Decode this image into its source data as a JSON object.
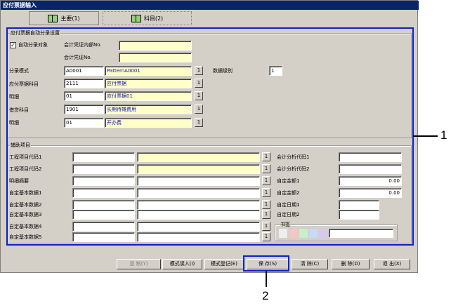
{
  "window": {
    "title": "应付票据输入"
  },
  "tabs": [
    {
      "label": "主要(1)",
      "icon": "book-icon"
    },
    {
      "label": "科目(2)",
      "icon": "book-icon"
    }
  ],
  "auto": {
    "group_title": "应付票据自动分录设置",
    "checkbox_label": "自动分录对象",
    "checkbox_checked": "✓",
    "voucher_inner_label": "会计凭证内部No.",
    "voucher_inner_value": "",
    "voucher_no_label": "会计凭证No.",
    "voucher_no_value": "",
    "pattern_label": "分录模式",
    "pattern_code": "A0001",
    "pattern_name": "PatternA0001",
    "level_label": "数据级别",
    "level_value": "1",
    "payable_label": "应付票据科目",
    "payable_code": "2111",
    "payable_name": "应付票据",
    "detail1_label": "明细",
    "detail1_code": "01",
    "detail1_name": "应付票据01",
    "credit_label": "借贷科目",
    "credit_code": "1901",
    "credit_name": "长期待摊费用",
    "detail2_label": "明细",
    "detail2_code": "01",
    "detail2_name": "开办费",
    "browse": "1"
  },
  "aux": {
    "group_title": "辅助项目",
    "left_labels": [
      "工程项目代码1",
      "工程项目代码2",
      "明细摘要",
      "自定基本数据1",
      "自定基本数据2",
      "自定基本数据3",
      "自定基本数据4",
      "自定基本数据5"
    ],
    "right_labels": [
      "会计分析代码1",
      "会计分析代码2",
      "自定金额1",
      "自定金额2",
      "自定日期1",
      "自定日期2"
    ],
    "right_values": [
      "",
      "",
      "0.00",
      "0.00",
      "",
      ""
    ],
    "bookmark_label": "书签",
    "bookmark_colors": [
      "#f4c6c6",
      "#c8f0c8",
      "#c8d8f8",
      "#d8c8f0"
    ]
  },
  "buttons": [
    "复 制(Y)",
    "模式读入(I)",
    "模式登记(E)",
    "保 存(S)",
    "清 除(C)",
    "删 除(D)",
    "退 出(X)"
  ],
  "callouts": [
    "1",
    "2"
  ]
}
